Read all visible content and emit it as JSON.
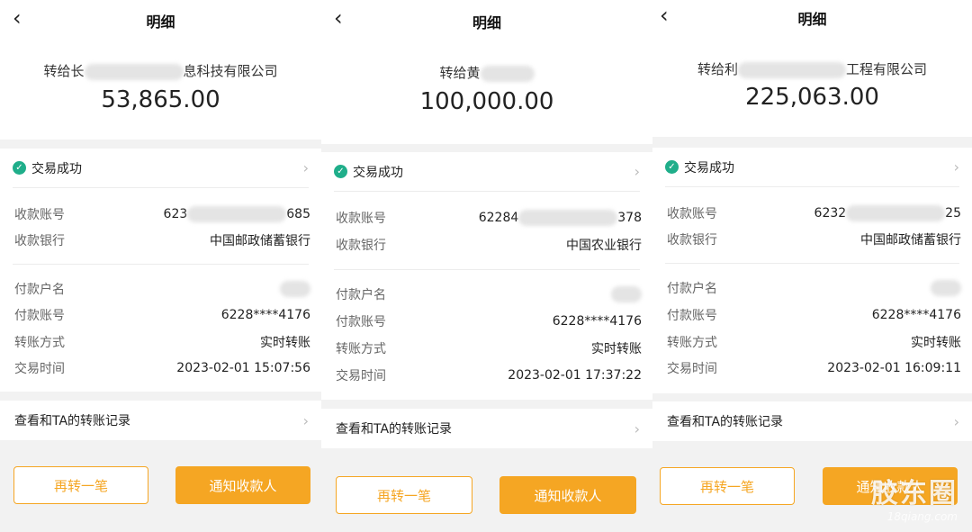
{
  "panels": [
    {
      "title": "明细",
      "transfer_to_prefix": "转给长",
      "transfer_to_suffix": "息科技有限公司",
      "amount": "53,865.00",
      "status": "交易成功",
      "fields": {
        "recv_account_label": "收款账号",
        "recv_account_prefix": "623",
        "recv_account_suffix": "685",
        "recv_bank_label": "收款银行",
        "recv_bank": "中国邮政储蓄银行",
        "payer_name_label": "付款户名",
        "payer_account_label": "付款账号",
        "payer_account": "6228****4176",
        "method_label": "转账方式",
        "method": "实时转账",
        "time_label": "交易时间",
        "time": "2023-02-01 15:07:56"
      },
      "history_link": "查看和TA的转账记录",
      "btn_again": "再转一笔",
      "btn_notify": "通知收款人"
    },
    {
      "title": "明细",
      "transfer_to_prefix": "转给黄",
      "transfer_to_suffix": "",
      "amount": "100,000.00",
      "status": "交易成功",
      "fields": {
        "recv_account_label": "收款账号",
        "recv_account_prefix": "62284",
        "recv_account_suffix": "378",
        "recv_bank_label": "收款银行",
        "recv_bank": "中国农业银行",
        "payer_name_label": "付款户名",
        "payer_account_label": "付款账号",
        "payer_account": "6228****4176",
        "method_label": "转账方式",
        "method": "实时转账",
        "time_label": "交易时间",
        "time": "2023-02-01 17:37:22"
      },
      "history_link": "查看和TA的转账记录",
      "btn_again": "再转一笔",
      "btn_notify": "通知收款人"
    },
    {
      "title": "明细",
      "transfer_to_prefix": "转给利",
      "transfer_to_suffix": "工程有限公司",
      "amount": "225,063.00",
      "status": "交易成功",
      "fields": {
        "recv_account_label": "收款账号",
        "recv_account_prefix": "6232",
        "recv_account_suffix": "25",
        "recv_bank_label": "收款银行",
        "recv_bank": "中国邮政储蓄银行",
        "payer_name_label": "付款户名",
        "payer_account_label": "付款账号",
        "payer_account": "6228****4176",
        "method_label": "转账方式",
        "method": "实时转账",
        "time_label": "交易时间",
        "time": "2023-02-01 16:09:11"
      },
      "history_link": "查看和TA的转账记录",
      "btn_again": "再转一笔",
      "btn_notify": "通知收款人"
    }
  ],
  "icons": {
    "back": "chevron-left-icon",
    "status": "check-circle-icon",
    "chevron": "chevron-right-icon"
  },
  "colors": {
    "accent": "#f5a623",
    "success": "#1fae8a"
  },
  "watermark": {
    "text": "胶东圈",
    "url": "18qiang.com"
  }
}
